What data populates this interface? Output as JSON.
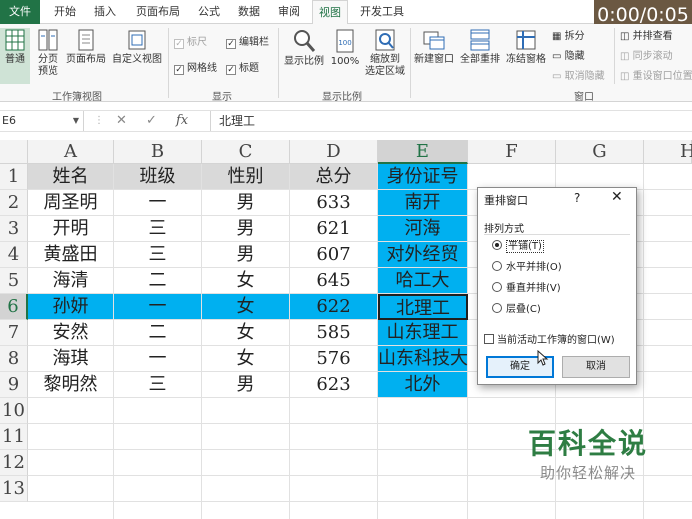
{
  "timer": "0:00/0:05",
  "ribbon": {
    "tabs": [
      "文件",
      "开始",
      "插入",
      "页面布局",
      "公式",
      "数据",
      "审阅",
      "视图",
      "开发工具"
    ],
    "workbook_views": {
      "normal": "普通",
      "page_break_line1": "分页",
      "page_break_line2": "预览",
      "page_layout": "页面布局",
      "custom_views": "自定义视图",
      "label": "工作簿视图"
    },
    "show": {
      "ruler": "标尺",
      "formula_bar": "编辑栏",
      "gridlines": "网格线",
      "headings": "标题",
      "label": "显示"
    },
    "zoom": {
      "zoom": "显示比例",
      "hundred": "100%",
      "to_selection_line1": "缩放到",
      "to_selection_line2": "选定区域",
      "label": "显示比例"
    },
    "window": {
      "new_window": "新建窗口",
      "arrange_all": "全部重排",
      "freeze_panes": "冻结窗格",
      "split": "拆分",
      "hide": "隐藏",
      "unhide": "取消隐藏",
      "side_by_side": "并排查看",
      "sync_scroll": "同步滚动",
      "reset_position": "重设窗口位置",
      "label": "窗口"
    }
  },
  "formula_bar": {
    "name_box": "E6",
    "value": "北理工",
    "fx": "fx"
  },
  "columns": [
    "A",
    "B",
    "C",
    "D",
    "E",
    "F",
    "G",
    "H"
  ],
  "rows": [
    "1",
    "2",
    "3",
    "4",
    "5",
    "6",
    "7",
    "8",
    "9",
    "10",
    "11",
    "12",
    "13"
  ],
  "table": {
    "headers": [
      "姓名",
      "班级",
      "性别",
      "总分",
      "身份证号"
    ],
    "data": [
      [
        "周圣明",
        "一",
        "男",
        "633",
        "南开"
      ],
      [
        "开明",
        "三",
        "男",
        "621",
        "河海"
      ],
      [
        "黄盛田",
        "三",
        "男",
        "607",
        "对外经贸"
      ],
      [
        "海清",
        "二",
        "女",
        "645",
        "哈工大"
      ],
      [
        "孙妍",
        "一",
        "女",
        "622",
        "北理工"
      ],
      [
        "安然",
        "二",
        "女",
        "585",
        "山东理工"
      ],
      [
        "海琪",
        "一",
        "女",
        "576",
        "山东科技大"
      ],
      [
        "黎明然",
        "三",
        "男",
        "623",
        "北外"
      ]
    ]
  },
  "dialog": {
    "title": "重排窗口",
    "help": "?",
    "close": "✕",
    "group_label": "排列方式",
    "options": [
      "平铺(T)",
      "水平并排(O)",
      "垂直并排(V)",
      "层叠(C)"
    ],
    "selected": 0,
    "checkbox_label": "当前活动工作簿的窗口(W)",
    "ok": "确定",
    "cancel": "取消"
  },
  "watermark": {
    "title": "百科全说",
    "subtitle": "助你轻松解决"
  },
  "colors": {
    "excel_green": "#217346",
    "highlight": "#00b0f0",
    "header_fill": "#d9d9d9",
    "timer_bg": "#6b5842"
  }
}
